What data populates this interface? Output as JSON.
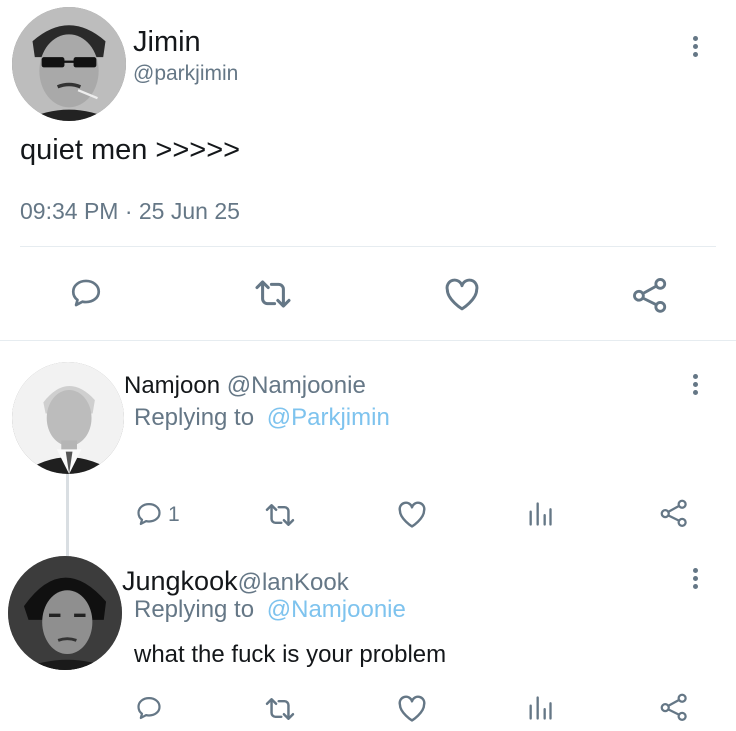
{
  "main_tweet": {
    "display_name": "Jimin",
    "handle": "@parkjimin",
    "text": "quiet men >>>>>",
    "timestamp": "09:34 PM · 25 Jun 25",
    "actions": [
      "reply-icon",
      "retweet-icon",
      "like-icon",
      "share-icon"
    ]
  },
  "replies": [
    {
      "display_name": "Namjoon",
      "handle": "@Namjoonie",
      "replying_prefix": "Replying to",
      "replying_to": "@Parkjimin",
      "text": "",
      "reply_count": "1",
      "actions": [
        "reply-icon",
        "retweet-icon",
        "like-icon",
        "analytics-icon",
        "share-icon"
      ]
    },
    {
      "display_name": "Jungkook",
      "handle": "@lanKook",
      "replying_prefix": "Replying to",
      "replying_to": "@Namjoonie",
      "text": "what the fuck is your problem",
      "reply_count": "",
      "actions": [
        "reply-icon",
        "retweet-icon",
        "like-icon",
        "analytics-icon",
        "share-icon"
      ]
    }
  ],
  "colors": {
    "text": "#14171a",
    "muted": "#657786",
    "link": "#7ec3ee",
    "divider": "#e6ecf0"
  }
}
